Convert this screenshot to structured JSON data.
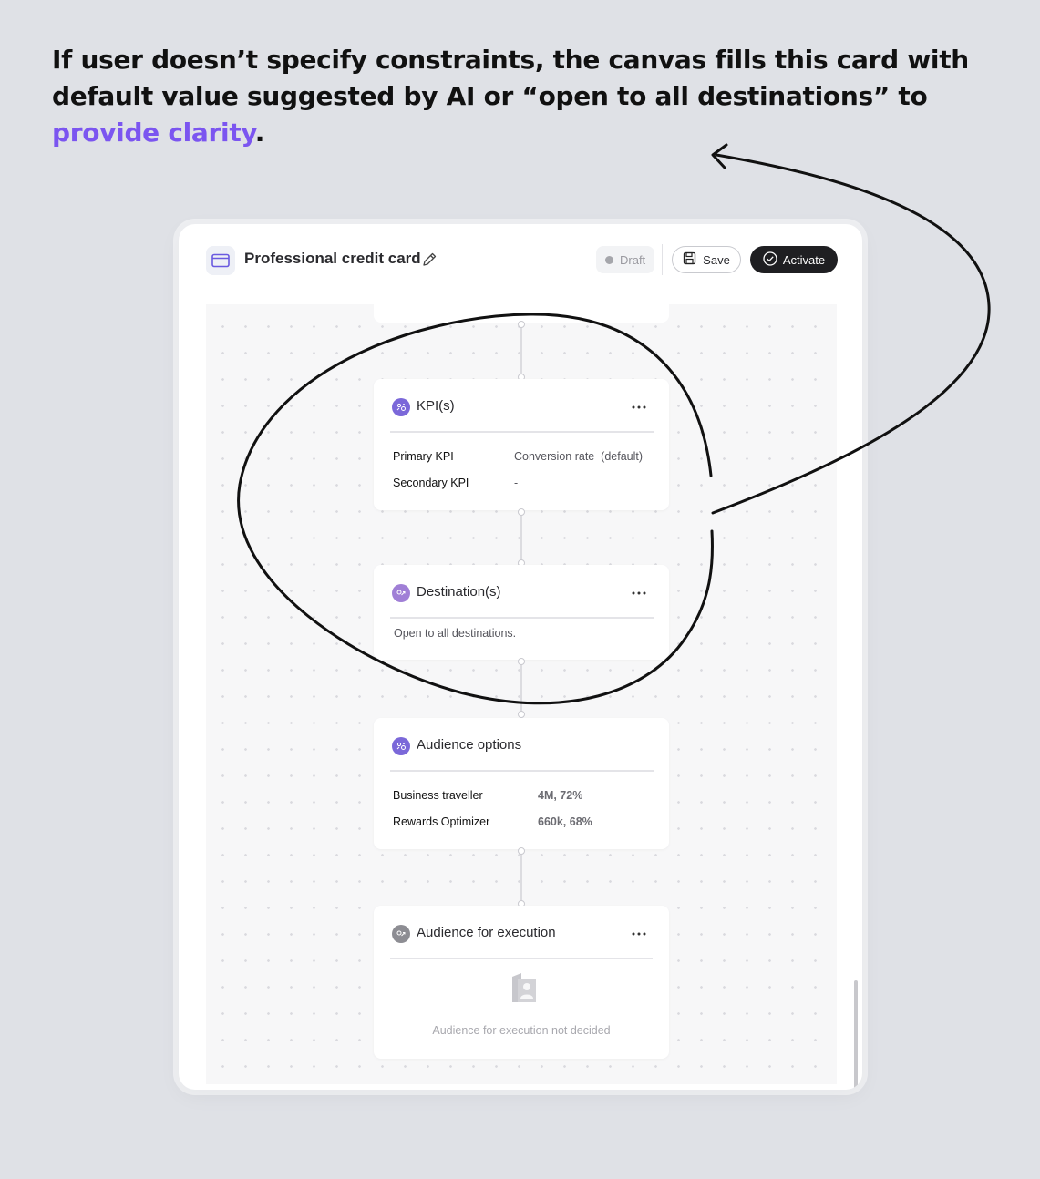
{
  "headline": {
    "text_main": "If user doesn’t specify constraints, the canvas fills this card with default value suggested by AI or “open to all destinations” to ",
    "text_accent": "provide clarity",
    "text_end": "."
  },
  "app": {
    "title": "Professional credit card",
    "status": "Draft",
    "save_label": "Save",
    "activate_label": "Activate"
  },
  "cards": {
    "kpi": {
      "title": "KPI(s)",
      "rows": [
        {
          "label": "Primary KPI",
          "value": "Conversion rate  (default)"
        },
        {
          "label": "Secondary KPI",
          "value": "-"
        }
      ]
    },
    "destinations": {
      "title": "Destination(s)",
      "text": "Open to all destinations."
    },
    "audience_options": {
      "title": "Audience options",
      "rows": [
        {
          "label": "Business traveller",
          "value": "4M, 72%"
        },
        {
          "label": "Rewards Optimizer",
          "value": "660k, 68%"
        }
      ]
    },
    "audience_execution": {
      "title": "Audience for execution",
      "empty_text": "Audience for execution not decided"
    }
  },
  "colors": {
    "accent": "#7b55f0",
    "background": "#dfe1e6",
    "activate_bg": "#1f1f22",
    "icon_purple": "#7b68d9"
  },
  "icons": [
    "card-icon",
    "pencil-icon",
    "save-icon",
    "check-circle-icon",
    "more-icon",
    "ai-sparkle-icon",
    "destination-icon",
    "audience-placeholder-icon"
  ]
}
